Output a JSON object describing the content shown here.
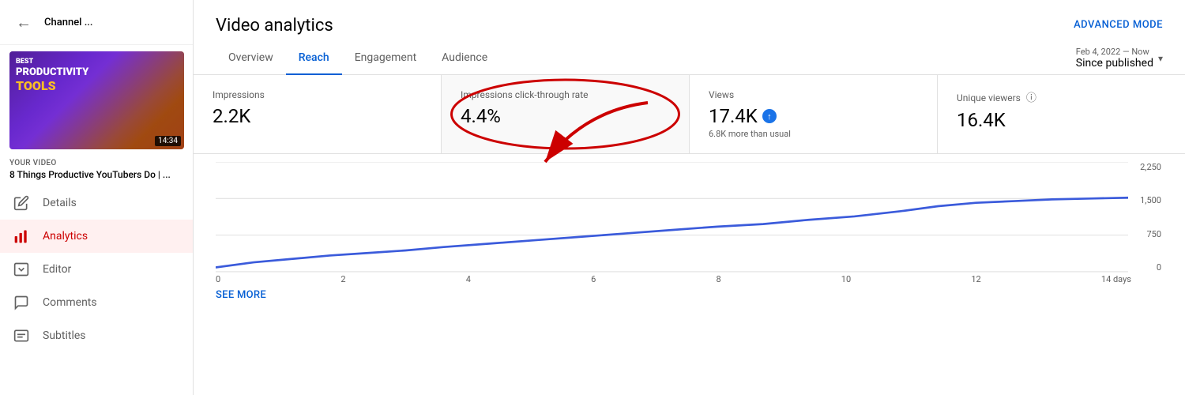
{
  "sidebar": {
    "back_icon": "←",
    "channel_name": "Channel ...",
    "video_label": "Your video",
    "video_title": "8 Things Productive YouTubers Do | ...",
    "thumbnail_duration": "14:34",
    "nav_items": [
      {
        "id": "details",
        "label": "Details",
        "icon": "✏️",
        "active": false
      },
      {
        "id": "analytics",
        "label": "Analytics",
        "icon": "📊",
        "active": true
      },
      {
        "id": "editor",
        "label": "Editor",
        "icon": "🎬",
        "active": false
      },
      {
        "id": "comments",
        "label": "Comments",
        "icon": "💬",
        "active": false
      },
      {
        "id": "subtitles",
        "label": "Subtitles",
        "icon": "📄",
        "active": false
      }
    ]
  },
  "header": {
    "title": "Video analytics",
    "advanced_mode": "ADVANCED MODE"
  },
  "tabs": [
    {
      "id": "overview",
      "label": "Overview",
      "active": false
    },
    {
      "id": "reach",
      "label": "Reach",
      "active": true
    },
    {
      "id": "engagement",
      "label": "Engagement",
      "active": false
    },
    {
      "id": "audience",
      "label": "Audience",
      "active": false
    }
  ],
  "date_range": {
    "small_label": "Feb 4, 2022 — Now",
    "main_label": "Since published"
  },
  "stats": [
    {
      "id": "impressions",
      "label": "Impressions",
      "value": "2.2K",
      "note": "",
      "highlighted": false,
      "show_info": false
    },
    {
      "id": "ctr",
      "label": "Impressions click-through rate",
      "value": "4.4%",
      "note": "",
      "highlighted": true,
      "show_info": false
    },
    {
      "id": "views",
      "label": "Views",
      "value": "17.4K",
      "note": "6.8K more than usual",
      "highlighted": false,
      "show_info": false
    },
    {
      "id": "unique-viewers",
      "label": "Unique viewers",
      "value": "16.4K",
      "note": "",
      "highlighted": false,
      "show_info": true
    }
  ],
  "chart": {
    "y_labels": [
      "2,250",
      "1,500",
      "750",
      "0"
    ],
    "x_labels": [
      "0",
      "2",
      "4",
      "6",
      "8",
      "10",
      "12",
      "14 days"
    ]
  },
  "see_more": "SEE MORE"
}
